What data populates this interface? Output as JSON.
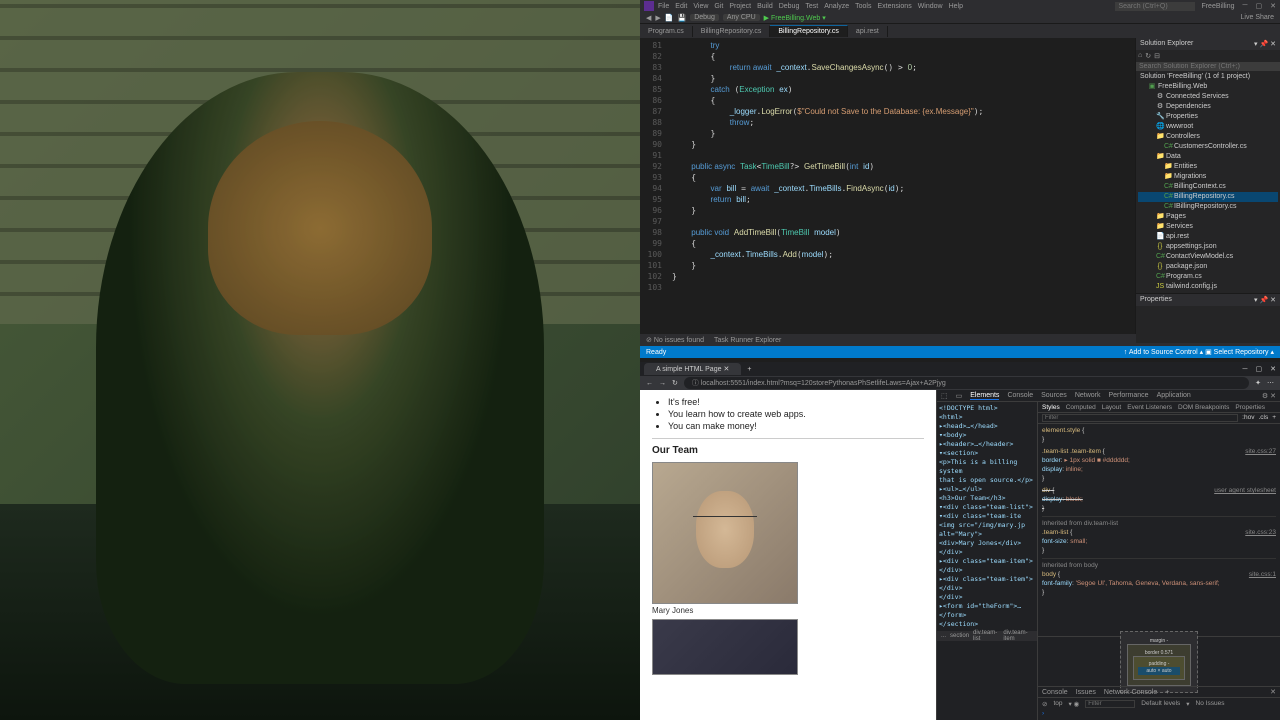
{
  "vs": {
    "menu": [
      "File",
      "Edit",
      "View",
      "Git",
      "Project",
      "Build",
      "Debug",
      "Test",
      "Analyze",
      "Tools",
      "Extensions",
      "Window",
      "Help"
    ],
    "search_placeholder": "Search (Ctrl+Q)",
    "title_suffix": "FreeBilling",
    "toolbar": {
      "config": "Debug",
      "platform": "Any CPU",
      "run": "FreeBilling.Web",
      "live_share": "Live Share"
    },
    "tabs": [
      {
        "label": "Program.cs",
        "active": false
      },
      {
        "label": "BillingRepository.cs",
        "active": false
      },
      {
        "label": "BillingRepository.cs",
        "active": true
      },
      {
        "label": "api.rest",
        "active": false
      }
    ],
    "line_start": 81,
    "code_lines": [
      "        <span class='kw'>try</span>",
      "        {",
      "            <span class='kw'>return await</span> <span class='var'>_context</span>.<span class='mth'>SaveChangesAsync</span>() &gt; <span class='num'>0</span>;",
      "        }",
      "        <span class='kw'>catch</span> (<span class='type'>Exception</span> <span class='var'>ex</span>)",
      "        {",
      "            <span class='var'>_logger</span>.<span class='mth'>LogError</span>(<span class='str'>$\"Could not Save to the Database: {ex.Message}\"</span>);",
      "            <span class='kw'>throw</span>;",
      "        }",
      "    }",
      "",
      "    <span class='kw'>public async</span> <span class='type'>Task</span>&lt;<span class='type'>TimeBill</span>?&gt; <span class='mth'>GetTimeBill</span>(<span class='kw'>int</span> <span class='var'>id</span>)",
      "    {",
      "        <span class='kw'>var</span> <span class='var'>bill</span> = <span class='kw'>await</span> <span class='var'>_context</span>.<span class='var'>TimeBills</span>.<span class='mth'>FindAsync</span>(<span class='var'>id</span>);",
      "        <span class='kw'>return</span> <span class='var'>bill</span>;",
      "    }",
      "",
      "    <span class='kw'>public void</span> <span class='mth'>AddTimeBill</span>(<span class='type'>TimeBill</span> <span class='var'>model</span>)",
      "    {",
      "        <span class='var'>_context</span>.<span class='var'>TimeBills</span>.<span class='mth'>Add</span>(<span class='var'>model</span>);",
      "    }",
      "}",
      ""
    ],
    "solution": {
      "title": "Solution Explorer",
      "search_placeholder": "Search Solution Explorer (Ctrl+;)",
      "root": "Solution 'FreeBilling' (1 of 1 project)",
      "project": "FreeBilling.Web",
      "nodes": [
        {
          "label": "Connected Services",
          "indent": 2,
          "ico": "⚙",
          "cls": ""
        },
        {
          "label": "Dependencies",
          "indent": 2,
          "ico": "⚙",
          "cls": ""
        },
        {
          "label": "Properties",
          "indent": 2,
          "ico": "🔧",
          "cls": ""
        },
        {
          "label": "wwwroot",
          "indent": 2,
          "ico": "🌐",
          "cls": ""
        },
        {
          "label": "Controllers",
          "indent": 2,
          "ico": "📁",
          "cls": "folder-ico"
        },
        {
          "label": "CustomersController.cs",
          "indent": 3,
          "ico": "C#",
          "cls": "cs-ico"
        },
        {
          "label": "Data",
          "indent": 2,
          "ico": "📁",
          "cls": "folder-ico"
        },
        {
          "label": "Entities",
          "indent": 3,
          "ico": "📁",
          "cls": "folder-ico"
        },
        {
          "label": "Migrations",
          "indent": 3,
          "ico": "📁",
          "cls": "folder-ico"
        },
        {
          "label": "BillingContext.cs",
          "indent": 3,
          "ico": "C#",
          "cls": "cs-ico"
        },
        {
          "label": "BillingRepository.cs",
          "indent": 3,
          "ico": "C#",
          "cls": "cs-ico",
          "selected": true
        },
        {
          "label": "IBillingRepository.cs",
          "indent": 3,
          "ico": "C#",
          "cls": "cs-ico"
        },
        {
          "label": "Pages",
          "indent": 2,
          "ico": "📁",
          "cls": "folder-ico"
        },
        {
          "label": "Services",
          "indent": 2,
          "ico": "📁",
          "cls": "folder-ico"
        },
        {
          "label": "api.rest",
          "indent": 2,
          "ico": "📄",
          "cls": ""
        },
        {
          "label": "appsettings.json",
          "indent": 2,
          "ico": "{}",
          "cls": "json-ico"
        },
        {
          "label": "ContactViewModel.cs",
          "indent": 2,
          "ico": "C#",
          "cls": "cs-ico"
        },
        {
          "label": "package.json",
          "indent": 2,
          "ico": "{}",
          "cls": "json-ico"
        },
        {
          "label": "Program.cs",
          "indent": 2,
          "ico": "C#",
          "cls": "cs-ico"
        },
        {
          "label": "tailwind.config.js",
          "indent": 2,
          "ico": "JS",
          "cls": "json-ico"
        }
      ]
    },
    "properties_title": "Properties",
    "bottom_tabs": [
      "No issues found",
      "Task Runner Explorer"
    ],
    "status": {
      "ready": "Ready",
      "add_source": "Add to Source Control",
      "select_repo": "Select Repository"
    }
  },
  "browser": {
    "tab_title": "A simple HTML Page",
    "url": "localhost:5551/index.html?msq=120storePythonasPhSetlifeLaws=Ajax+A2Pjyg",
    "page": {
      "bullets": [
        "It's free!",
        "You learn how to create web apps.",
        "You can make money!"
      ],
      "heading": "Our Team",
      "caption1": "Mary Jones"
    },
    "devtools": {
      "main_tabs": [
        "Elements",
        "Console",
        "Sources",
        "Network",
        "Performance",
        "Application"
      ],
      "style_tabs": [
        "Styles",
        "Computed",
        "Layout",
        "Event Listeners",
        "DOM Breakpoints",
        "Properties"
      ],
      "filter_placeholder": "Filter",
      "hov": ":hov",
      "cls": ".cls",
      "elements_html": "&lt;!DOCTYPE html&gt;\n&lt;html&gt;\n ▸&lt;head&gt;…&lt;/head&gt;\n ▾&lt;body&gt;\n  ▸&lt;header&gt;…&lt;/header&gt;\n  ▾&lt;section&gt;\n    &lt;p&gt;This is a billing system\n    that is open source.&lt;/p&gt;\n   ▸&lt;ul&gt;…&lt;/ul&gt;\n    &lt;h3&gt;Our Team&lt;/h3&gt;\n   ▾&lt;div class=\"team-list\"&gt;\n    ▾&lt;div class=\"team-ite\n      &lt;img src=\"/img/mary.jp\n      alt=\"Mary\"&gt;\n      &lt;div&gt;Mary Jones&lt;/div&gt;\n     &lt;/div&gt;\n    ▸&lt;div class=\"team-item\"&gt;\n     &lt;/div&gt;\n    ▸&lt;div class=\"team-item\"&gt;\n     &lt;/div&gt;\n    &lt;/div&gt;\n   ▸&lt;form id=\"theForm\"&gt;…&lt;/form&gt;\n  &lt;/section&gt;",
      "breadcrumb": [
        "...",
        "section",
        "div.team-list",
        "div.team-item"
      ],
      "rules": [
        {
          "selector": "element.style",
          "src": "",
          "body": ""
        },
        {
          "selector": ".team-list .team-item",
          "src": "site.css:27",
          "body": "border: ▸ 1px solid ■ #dddddd;\ndisplay: inline;"
        },
        {
          "selector": "div",
          "src": "user agent stylesheet",
          "body": "display: block;",
          "strike": true
        },
        {
          "header": "Inherited from div.team-list"
        },
        {
          "selector": ".team-list",
          "src": "site.css:23",
          "body": "font-size: small;"
        },
        {
          "header": "Inherited from body"
        },
        {
          "selector": "body",
          "src": "site.css:1",
          "body": "font-family: 'Segoe UI', Tahoma, Geneva, Verdana, sans-serif;"
        }
      ],
      "boxmodel": {
        "margin": "-",
        "border": "0.571",
        "padding": "-",
        "content": "auto × auto"
      },
      "console_tabs": [
        "Console",
        "Issues",
        "Network Console"
      ],
      "console_filter": {
        "top": "top",
        "filter": "Filter",
        "levels": "Default levels",
        "issues": "No Issues"
      }
    }
  }
}
